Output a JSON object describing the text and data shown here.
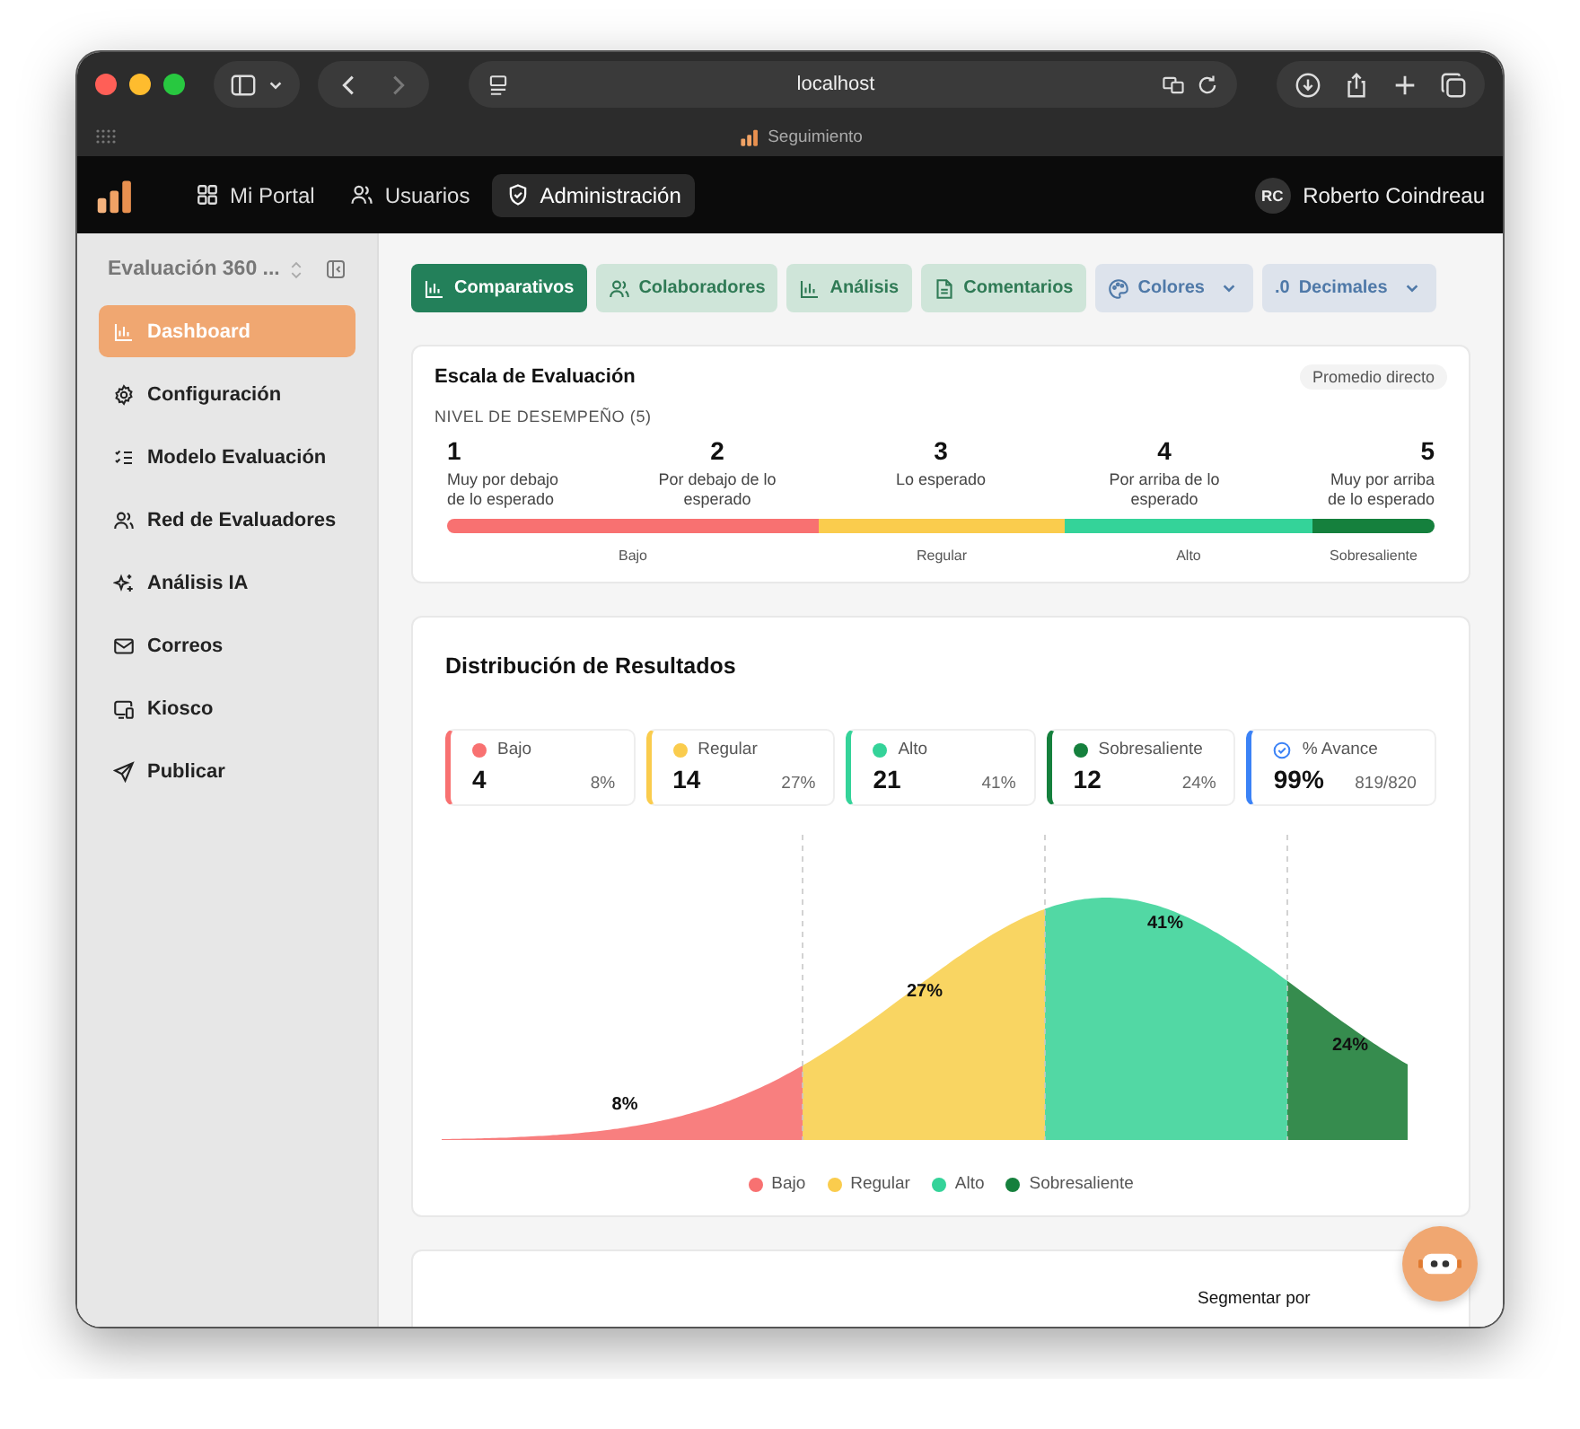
{
  "browser": {
    "address": "localhost",
    "tab_title": "Seguimiento"
  },
  "topnav": {
    "items": [
      {
        "label": "Mi Portal",
        "selected": false
      },
      {
        "label": "Usuarios",
        "selected": false
      },
      {
        "label": "Administración",
        "selected": true
      }
    ],
    "user": {
      "initials": "RC",
      "name": "Roberto Coindreau"
    }
  },
  "sidebar": {
    "project": "Evaluación 360 ...",
    "items": [
      {
        "label": "Dashboard",
        "selected": true
      },
      {
        "label": "Configuración",
        "selected": false
      },
      {
        "label": "Modelo Evaluación",
        "selected": false
      },
      {
        "label": "Red de Evaluadores",
        "selected": false
      },
      {
        "label": "Análisis IA",
        "selected": false
      },
      {
        "label": "Correos",
        "selected": false
      },
      {
        "label": "Kiosco",
        "selected": false
      },
      {
        "label": "Publicar",
        "selected": false
      }
    ]
  },
  "tabs": [
    {
      "label": "Comparativos",
      "kind": "tab",
      "selected": true
    },
    {
      "label": "Colaboradores",
      "kind": "tab",
      "selected": false
    },
    {
      "label": "Análisis",
      "kind": "tab",
      "selected": false
    },
    {
      "label": "Comentarios",
      "kind": "tab",
      "selected": false
    },
    {
      "label": "Colores",
      "kind": "dropdown",
      "selected": false
    },
    {
      "label": "Decimales",
      "prefix": ".0",
      "kind": "dropdown",
      "selected": false
    }
  ],
  "scale": {
    "title": "Escala de Evaluación",
    "badge": "Promedio directo",
    "subtitle": "NIVEL DE DESEMPEÑO (5)",
    "levels": [
      {
        "number": "1",
        "text": "Muy por debajo de lo esperado"
      },
      {
        "number": "2",
        "text": "Por debajo de lo esperado"
      },
      {
        "number": "3",
        "text": "Lo esperado"
      },
      {
        "number": "4",
        "text": "Por arriba de lo esperado"
      },
      {
        "number": "5",
        "text": "Muy por arriba de lo esperado"
      }
    ],
    "bands": [
      {
        "label": "Bajo",
        "color": "#f87171"
      },
      {
        "label": "Regular",
        "color": "#facc4d"
      },
      {
        "label": "Alto",
        "color": "#34d399"
      },
      {
        "label": "Sobresaliente",
        "color": "#15803d"
      }
    ]
  },
  "distribution": {
    "title": "Distribución de Resultados",
    "stats": [
      {
        "kind": "level",
        "label": "Bajo",
        "value": "4",
        "percent": "8%",
        "color": "#f87171"
      },
      {
        "kind": "level",
        "label": "Regular",
        "value": "14",
        "percent": "27%",
        "color": "#facc4d"
      },
      {
        "kind": "level",
        "label": "Alto",
        "value": "21",
        "percent": "41%",
        "color": "#34d399"
      },
      {
        "kind": "level",
        "label": "Sobresaliente",
        "value": "12",
        "percent": "24%",
        "color": "#15803d"
      },
      {
        "kind": "progress",
        "label": "% Avance",
        "value": "99%",
        "percent": "819/820",
        "color": "#3b82f6"
      }
    ],
    "curve": [
      {
        "label": "8%",
        "color": "#f87f7f"
      },
      {
        "label": "27%",
        "color": "#f9d562"
      },
      {
        "label": "41%",
        "color": "#52d8a4"
      },
      {
        "label": "24%",
        "color": "#368c4e"
      }
    ],
    "legend": [
      {
        "label": "Bajo",
        "color": "#f87171"
      },
      {
        "label": "Regular",
        "color": "#facc4d"
      },
      {
        "label": "Alto",
        "color": "#34d399"
      },
      {
        "label": "Sobresaliente",
        "color": "#15803d"
      }
    ]
  },
  "next_card": {
    "label": "Segmentar por"
  }
}
